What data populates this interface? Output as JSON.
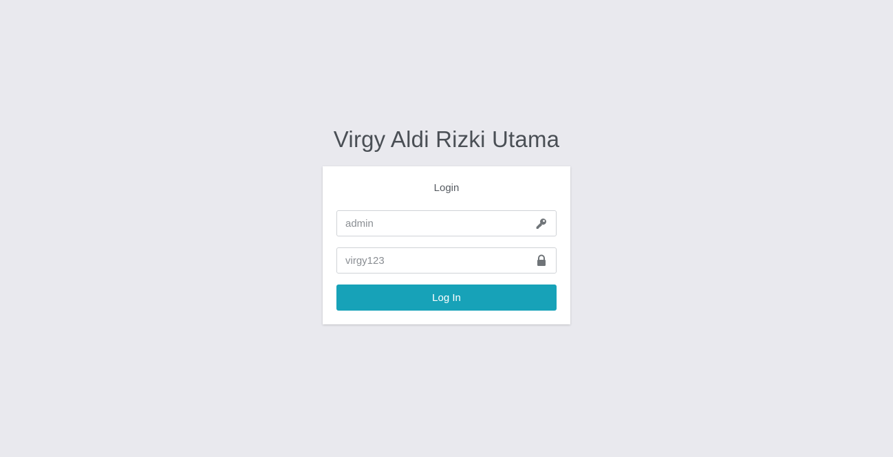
{
  "app": {
    "title": "Virgy Aldi Rizki Utama"
  },
  "login_box": {
    "title": "Login",
    "username": {
      "placeholder": "admin",
      "icon": "key-icon"
    },
    "password": {
      "placeholder": "virgy123",
      "icon": "lock-icon"
    },
    "submit_label": "Log In"
  },
  "colors": {
    "background": "#e9e9ee",
    "accent": "#17a2b8",
    "title_text": "#4a4f55"
  }
}
